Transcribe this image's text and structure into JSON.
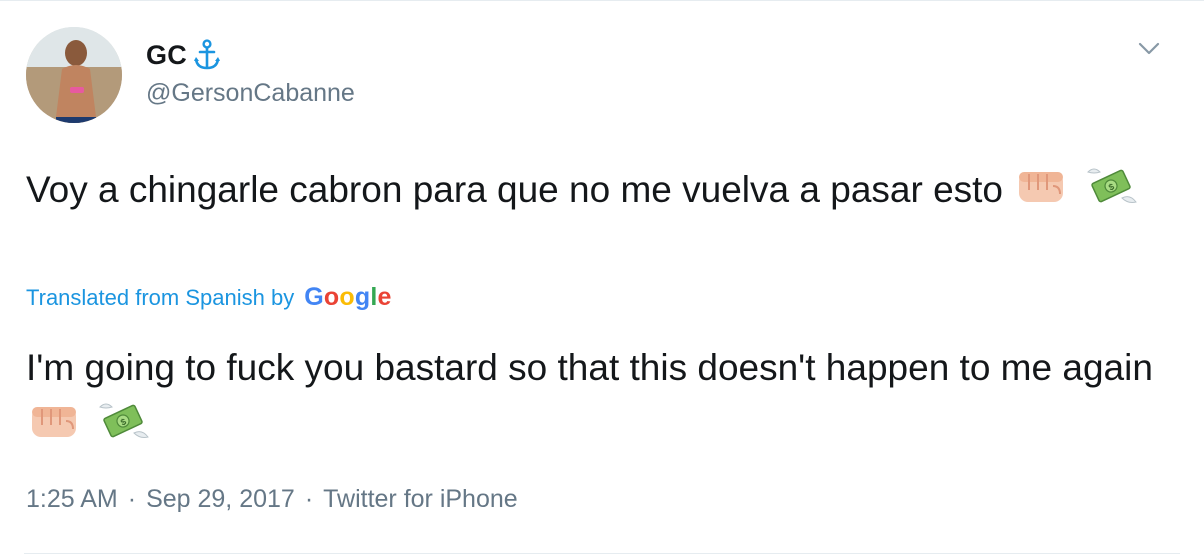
{
  "user": {
    "display_name": "GC",
    "badge_icon": "anchor-icon",
    "handle": "@GersonCabanne"
  },
  "tweet": {
    "text": "Voy a chingarle cabron para que no me vuelva a pasar esto",
    "emojis": [
      "fist-icon",
      "flying-money-icon"
    ]
  },
  "translation": {
    "label": "Translated from Spanish by",
    "provider": "Google",
    "text": "I'm going to fuck you bastard so that this doesn't happen to me again"
  },
  "meta": {
    "time": "1:25 AM",
    "separator": "·",
    "date": "Sep 29, 2017",
    "source": "Twitter for iPhone"
  },
  "colors": {
    "link": "#1b95e0",
    "secondary_text": "#657786",
    "anchor": "#1b95e0"
  }
}
